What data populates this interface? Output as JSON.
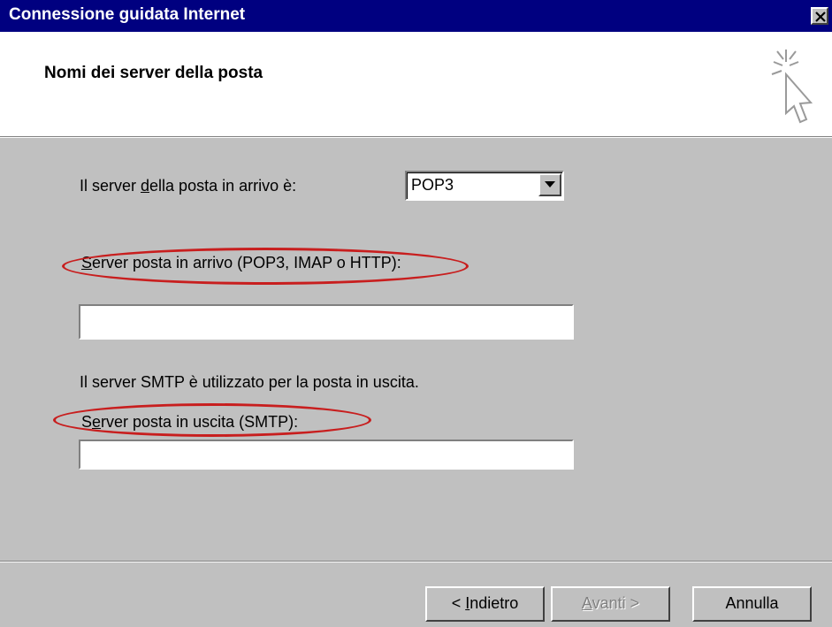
{
  "window": {
    "title": "Connessione guidata Internet"
  },
  "header": {
    "title": "Nomi dei server della posta"
  },
  "form": {
    "incoming_type_label_pre": "Il server ",
    "incoming_type_label_u": "d",
    "incoming_type_label_post": "ella posta in arrivo è:",
    "incoming_type_value": "POP3",
    "incoming_server_label_u": "S",
    "incoming_server_label_post": "erver posta in arrivo (POP3, IMAP o HTTP):",
    "incoming_server_value": "",
    "smtp_note": "Il server SMTP è utilizzato per la posta in uscita.",
    "outgoing_server_label_pre": "S",
    "outgoing_server_label_u": "e",
    "outgoing_server_label_post": "rver posta in uscita (SMTP):",
    "outgoing_server_value": ""
  },
  "buttons": {
    "back_pre": "< ",
    "back_u": "I",
    "back_post": "ndietro",
    "next_u": "A",
    "next_post": "vanti >",
    "cancel": "Annulla"
  },
  "colors": {
    "titlebar": "#000080",
    "annotation": "#c81e1e",
    "face": "#c0c0c0"
  },
  "icons": [
    "close-icon",
    "wizard-cursor-icon",
    "dropdown-arrow-icon"
  ]
}
